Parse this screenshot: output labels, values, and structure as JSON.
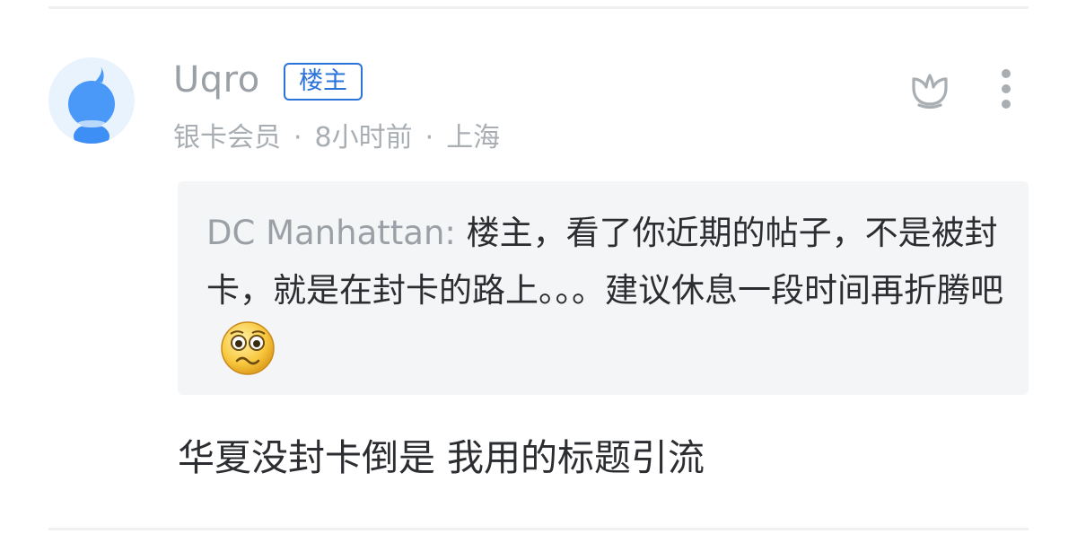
{
  "comment": {
    "username": "Uqro",
    "op_badge": "楼主",
    "member_level": "银卡会员",
    "time": "8小时前",
    "location": "上海",
    "meta_separator": "·",
    "quote": {
      "author": "DC Manhattan:",
      "text": "楼主，看了你近期的帖子，不是被封卡，就是在封卡的路上。。。建议休息一段时间再折腾吧",
      "emoji": "worried-face-emoji"
    },
    "reply_text": "华夏没封卡倒是 我用的标题引流"
  },
  "icons": {
    "avatar": "default-bird-avatar",
    "like": "lotus-like-icon",
    "more": "vertical-dots-icon"
  },
  "colors": {
    "accent": "#2a73d9",
    "avatar_bg": "#e9f3fd",
    "avatar_bird": "#3d8ef5",
    "quote_bg": "#f4f5f6",
    "muted_text": "#9aa0a6",
    "body_text": "#2b2d30"
  }
}
